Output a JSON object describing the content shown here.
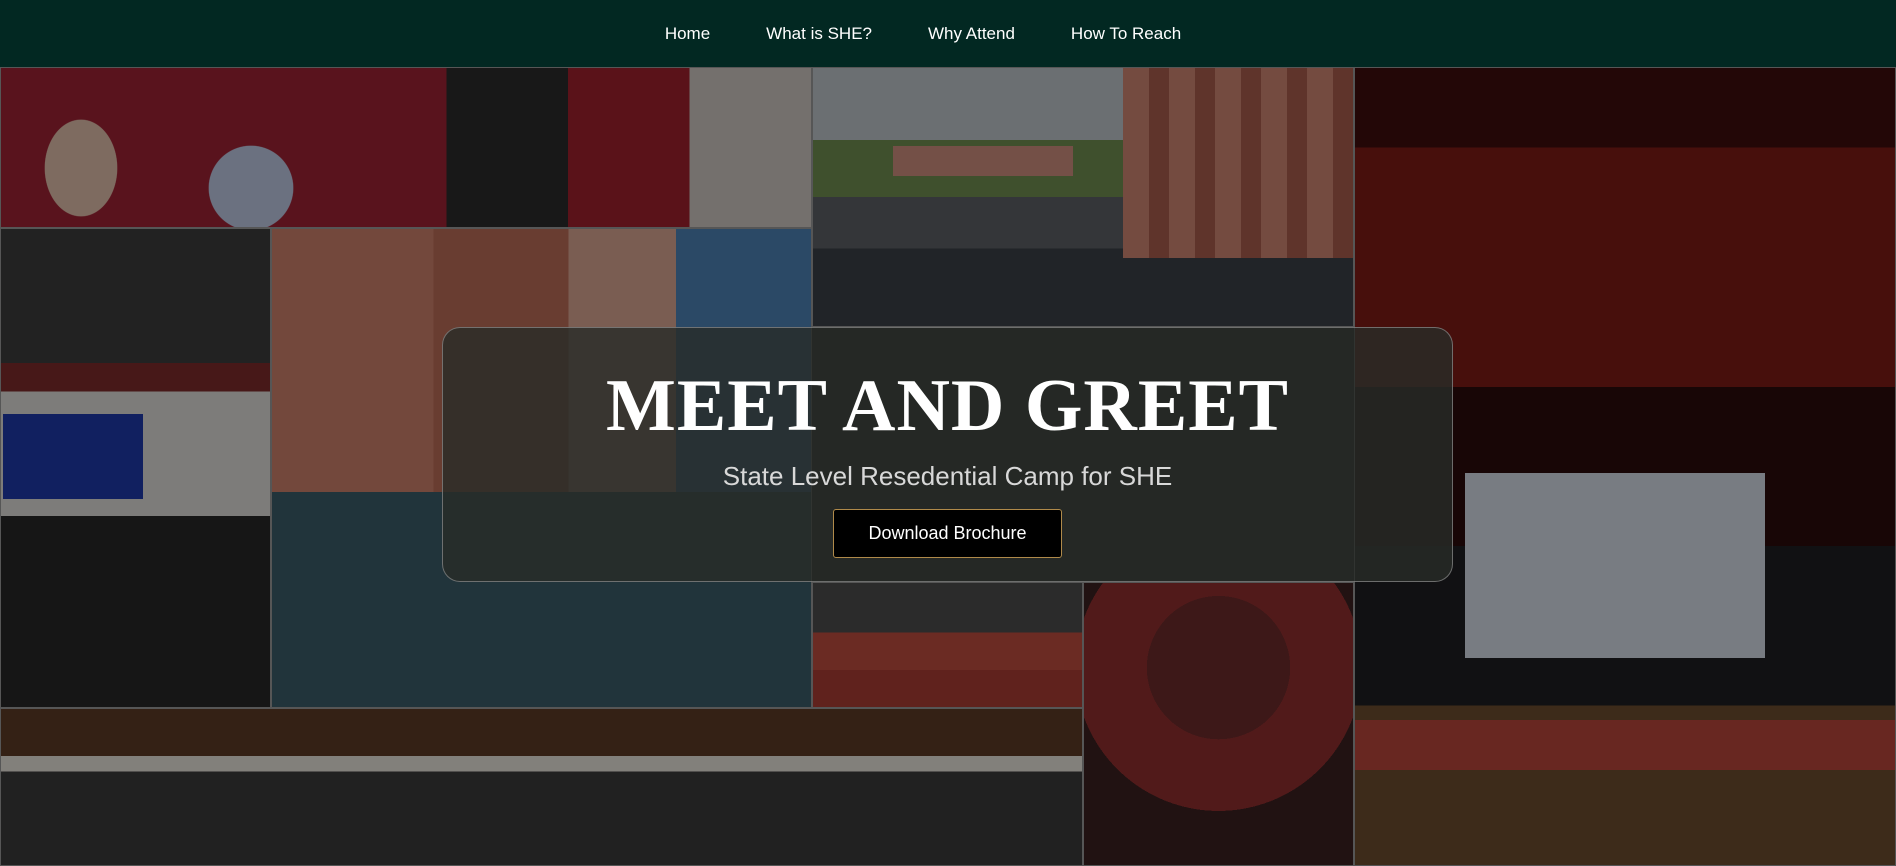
{
  "nav": {
    "links": [
      {
        "label": "Home"
      },
      {
        "label": "What is SHE?"
      },
      {
        "label": "Why Attend"
      },
      {
        "label": "How To Reach"
      }
    ]
  },
  "hero": {
    "title": "MEET AND GREET",
    "subtitle": "State Level Resedential Camp for SHE",
    "button_label": "Download Brochure"
  },
  "colors": {
    "navbar_bg": "#022822",
    "button_bg": "#000000",
    "button_border": "#b08a4a"
  }
}
